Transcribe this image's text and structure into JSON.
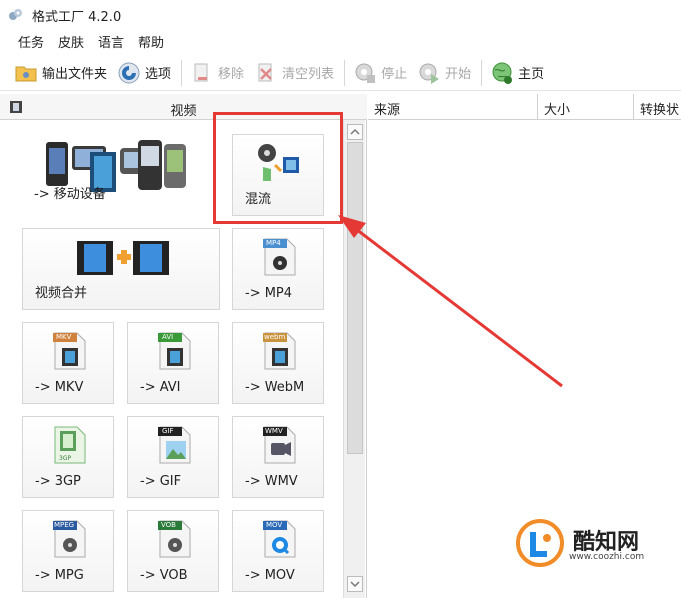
{
  "window": {
    "title": "格式工厂 4.2.0"
  },
  "menu": {
    "items": [
      "任务",
      "皮肤",
      "语言",
      "帮助"
    ]
  },
  "toolbar": {
    "output_folder": "输出文件夹",
    "options": "选项",
    "remove": "移除",
    "clear_list": "清空列表",
    "stop": "停止",
    "start": "开始",
    "home": "主页"
  },
  "category": {
    "title": "视频"
  },
  "tiles": {
    "mobile": "-> 移动设备",
    "mux": "混流",
    "merge": "视频合并",
    "mp4": "-> MP4",
    "mkv": "-> MKV",
    "avi": "-> AVI",
    "webm": "-> WebM",
    "gp3": "-> 3GP",
    "gif": "-> GIF",
    "wmv": "-> WMV",
    "mpg": "-> MPG",
    "vob": "-> VOB",
    "mov": "-> MOV"
  },
  "icon_badges": {
    "mp4": "MP4",
    "mkv": "MKV",
    "avi": "AVI",
    "webm": "webm",
    "gp3": "3GP",
    "gif": "GIF",
    "wmv": "WMV",
    "mpg": "MPEG",
    "vob": "VOB",
    "mov": "MOV"
  },
  "table": {
    "columns": [
      "来源",
      "大小",
      "转换状"
    ]
  },
  "watermark": {
    "text": "酷知网",
    "url": "www.coozhi.com"
  },
  "colors": {
    "annotation": "#e53935",
    "accent_blue": "#1565c0"
  }
}
